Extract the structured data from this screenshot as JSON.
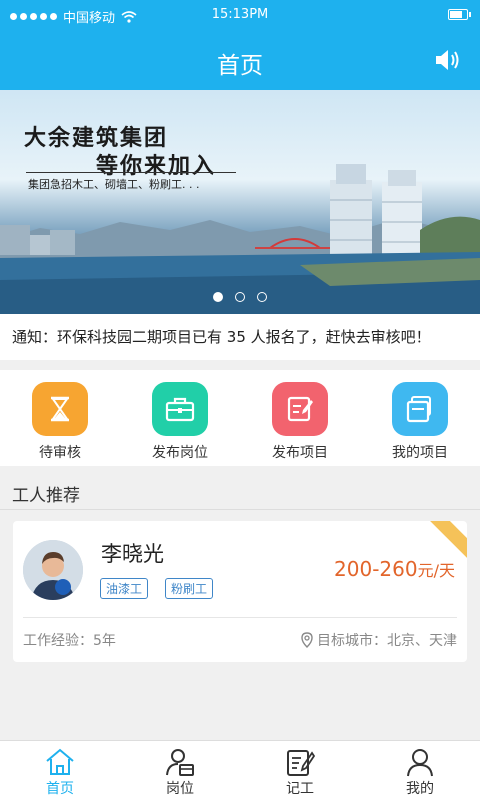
{
  "status": {
    "carrier": "中国移动",
    "time": "15:13PM"
  },
  "nav": {
    "title": "首页"
  },
  "banner": {
    "line1": "大余建筑集团",
    "line2": "等你来加入",
    "line3": "集团急招木工、砌墙工、粉刷工. . ."
  },
  "notice": {
    "text": "通知：环保科技园二期项目已有 35 人报名了，赶快去审核吧！"
  },
  "quick_actions": [
    {
      "label": "待审核",
      "color": "#f7a531",
      "icon": "hourglass-icon"
    },
    {
      "label": "发布岗位",
      "color": "#21cfa8",
      "icon": "briefcase-icon"
    },
    {
      "label": "发布项目",
      "color": "#f2636e",
      "icon": "edit-icon"
    },
    {
      "label": "我的项目",
      "color": "#3fb8f0",
      "icon": "folder-icon"
    }
  ],
  "section": {
    "title": "工人推荐"
  },
  "worker": {
    "name": "李晓光",
    "tags": [
      "油漆工",
      "粉刷工"
    ],
    "wage": "200-260",
    "wage_unit": "元/天",
    "experience": "工作经验：5年",
    "cities": "目标城市：北京、天津"
  },
  "tabs": [
    {
      "label": "首页",
      "active": true
    },
    {
      "label": "岗位",
      "active": false
    },
    {
      "label": "记工",
      "active": false
    },
    {
      "label": "我的",
      "active": false
    }
  ],
  "colors": {
    "primary": "#1eb1ee",
    "accent": "#e2652b",
    "tag": "#3f86c8"
  }
}
